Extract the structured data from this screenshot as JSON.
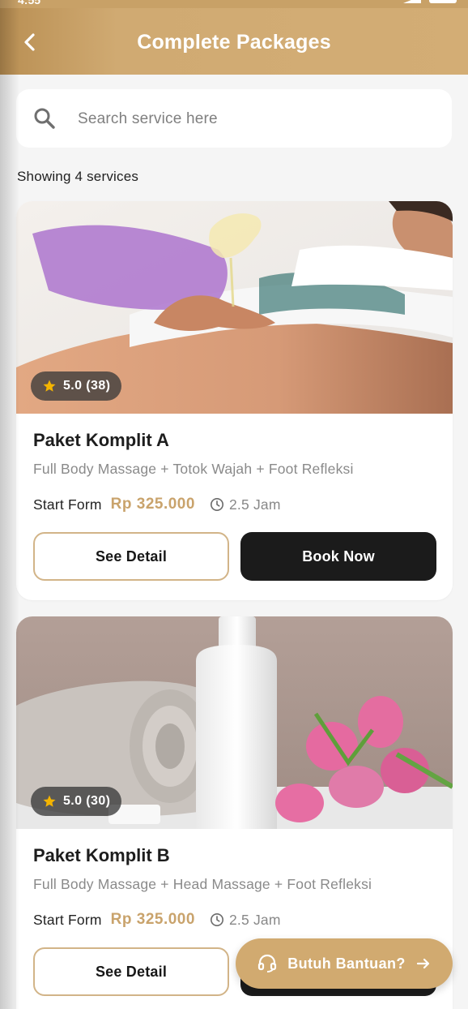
{
  "status_bar": {
    "time": "4:55"
  },
  "header": {
    "title": "Complete Packages",
    "back_icon": "chevron-left-icon"
  },
  "search": {
    "placeholder": "Search service here",
    "icon": "search-icon"
  },
  "results": {
    "showing_text": "Showing 4 services"
  },
  "services": [
    {
      "rating_text": "5.0 (38)",
      "title": "Paket Komplit A",
      "description": "Full Body Massage + Totok Wajah + Foot Refleksi",
      "start_label": "Start Form",
      "price": "Rp 325.000",
      "duration": "2.5 Jam",
      "detail_label": "See Detail",
      "book_label": "Book Now"
    },
    {
      "rating_text": "5.0 (30)",
      "title": "Paket Komplit B",
      "description": "Full Body Massage + Head Massage + Foot Refleksi",
      "start_label": "Start Form",
      "price": "Rp 325.000",
      "duration": "2.5 Jam",
      "detail_label": "See Detail",
      "book_label": "Book Now"
    }
  ],
  "help_fab": {
    "label": "Butuh Bantuan?",
    "icon": "headset-icon",
    "arrow_icon": "arrow-right-icon"
  },
  "colors": {
    "brand_gold": "#d3ad75",
    "price_gold": "#c9a36c",
    "dark_button": "#1b1b1b",
    "star": "#f4b400"
  }
}
